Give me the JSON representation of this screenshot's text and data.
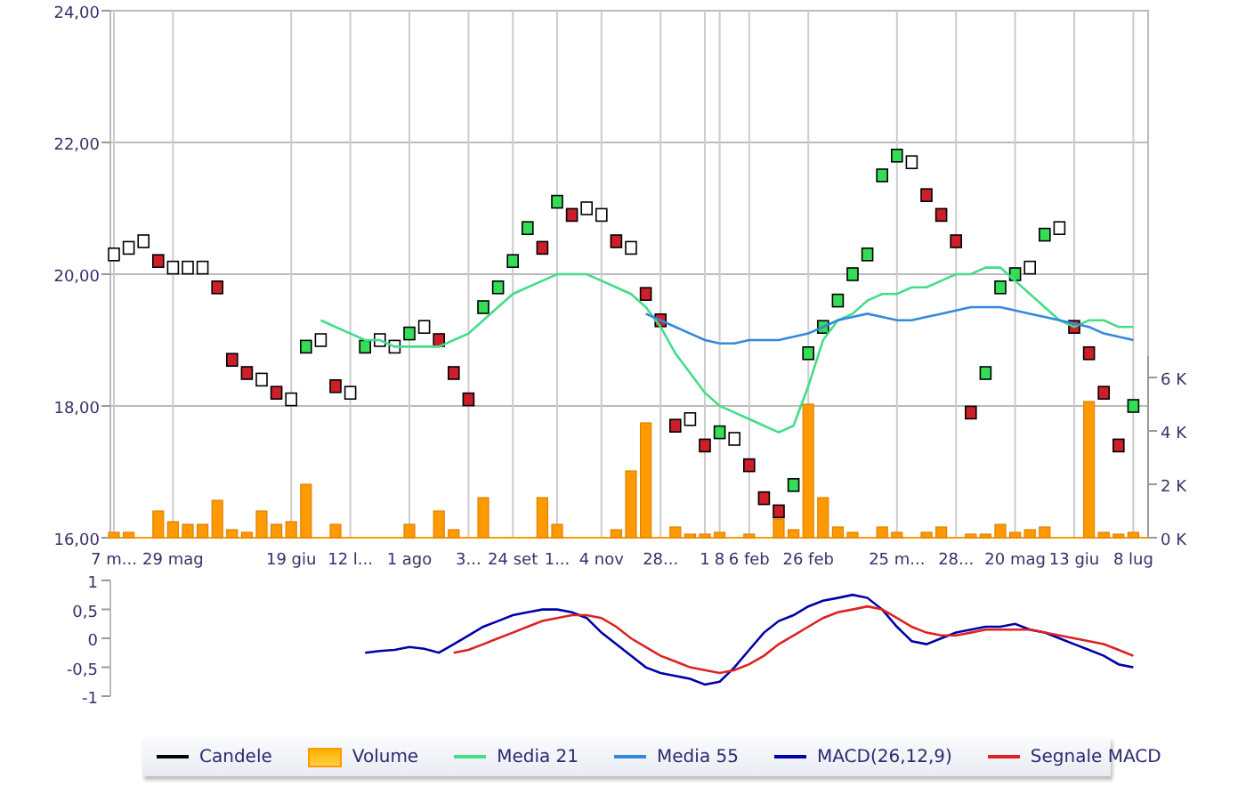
{
  "price_panel": {
    "chart_data": {
      "type": "line",
      "categories": [
        "7 m...",
        null,
        null,
        null,
        "29 mag",
        null,
        null,
        null,
        null,
        null,
        null,
        null,
        "19 giu",
        null,
        null,
        null,
        "12 l...",
        null,
        null,
        null,
        "1 ago",
        null,
        null,
        null,
        "3...",
        null,
        null,
        "24 set",
        null,
        null,
        "1...",
        null,
        null,
        "4 nov",
        null,
        null,
        null,
        "28...",
        null,
        null,
        "1",
        "8",
        null,
        "6 feb",
        null,
        null,
        null,
        "26 feb",
        null,
        null,
        null,
        null,
        null,
        "25 m...",
        null,
        null,
        null,
        "28...",
        null,
        null,
        null,
        "20 mag",
        null,
        null,
        null,
        "13 giu",
        null,
        null,
        null,
        "8 lug"
      ],
      "yticks": [
        {
          "value": 24,
          "label": "24,00"
        },
        {
          "value": 22,
          "label": "22,00"
        },
        {
          "value": 20,
          "label": "20,00"
        },
        {
          "value": 18,
          "label": "18,00"
        },
        {
          "value": 16,
          "label": "16,00"
        }
      ],
      "ylim": [
        16,
        24
      ],
      "grid": true,
      "y2ticks": [
        {
          "value": 6,
          "label": "6 K"
        },
        {
          "value": 4,
          "label": "4 K"
        },
        {
          "value": 2,
          "label": "2 K"
        },
        {
          "value": 0,
          "label": "0 K"
        }
      ],
      "y2lim": [
        0,
        6.8
      ],
      "series": [
        {
          "name": "Candele",
          "type": "scatter",
          "color": "#000000",
          "values": [
            20.3,
            20.4,
            20.5,
            20.2,
            20.1,
            20.1,
            20.1,
            19.8,
            18.7,
            18.5,
            18.4,
            18.2,
            18.1,
            18.9,
            19.0,
            18.3,
            18.2,
            18.9,
            19.0,
            18.9,
            19.1,
            19.2,
            19.0,
            18.5,
            18.1,
            19.5,
            19.8,
            20.2,
            20.7,
            20.4,
            21.1,
            20.9,
            21.0,
            20.9,
            20.5,
            20.4,
            19.7,
            19.3,
            17.7,
            17.8,
            17.4,
            17.6,
            17.5,
            17.1,
            16.6,
            16.4,
            16.8,
            18.8,
            19.2,
            19.6,
            20.0,
            20.3,
            21.5,
            21.8,
            21.7,
            21.2,
            20.9,
            20.5,
            17.9,
            18.5,
            19.8,
            20.0,
            20.1,
            20.6,
            20.7,
            19.2,
            18.8,
            18.2,
            17.4,
            18.0
          ]
        },
        {
          "name": "Volume",
          "type": "bar",
          "axis": "y2",
          "color": "#ff9900",
          "values": [
            0.2,
            0.2,
            0,
            1.0,
            0.6,
            0.5,
            0.5,
            1.4,
            0.3,
            0.2,
            1.0,
            0.5,
            0.6,
            2.0,
            0,
            0.5,
            0,
            0,
            0,
            0,
            0.5,
            0,
            1.0,
            0.3,
            0,
            1.5,
            0,
            0,
            0,
            1.5,
            0.5,
            0,
            0,
            0,
            0.3,
            2.5,
            4.3,
            0,
            0.4,
            0.1,
            0.1,
            0.2,
            0,
            0.1,
            0,
            0.7,
            0.3,
            5.0,
            1.5,
            0.4,
            0.2,
            0,
            0.4,
            0.2,
            0,
            0.2,
            0.4,
            0,
            0.1,
            0.1,
            0.5,
            0.2,
            0.3,
            0.4,
            0,
            0,
            5.1,
            0.2,
            0.1,
            0.2
          ]
        },
        {
          "name": "Media 21",
          "type": "line",
          "color": "#44dd88",
          "values": [
            null,
            null,
            null,
            null,
            null,
            null,
            null,
            null,
            null,
            null,
            null,
            null,
            null,
            null,
            19.3,
            19.2,
            19.1,
            19.0,
            19.0,
            18.9,
            18.9,
            18.9,
            18.9,
            19.0,
            19.1,
            19.3,
            19.5,
            19.7,
            19.8,
            19.9,
            20.0,
            20.0,
            20.0,
            19.9,
            19.8,
            19.7,
            19.5,
            19.2,
            18.8,
            18.5,
            18.2,
            18.0,
            17.9,
            17.8,
            17.7,
            17.6,
            17.7,
            18.3,
            19.0,
            19.3,
            19.4,
            19.6,
            19.7,
            19.7,
            19.8,
            19.8,
            19.9,
            20.0,
            20.0,
            20.1,
            20.1,
            19.9,
            19.7,
            19.5,
            19.3,
            19.2,
            19.3,
            19.3,
            19.2,
            19.2
          ]
        },
        {
          "name": "Media 55",
          "type": "line",
          "color": "#3388dd",
          "values": [
            null,
            null,
            null,
            null,
            null,
            null,
            null,
            null,
            null,
            null,
            null,
            null,
            null,
            null,
            null,
            null,
            null,
            null,
            null,
            null,
            null,
            null,
            null,
            null,
            null,
            null,
            null,
            null,
            null,
            null,
            null,
            null,
            null,
            null,
            null,
            null,
            19.4,
            19.3,
            19.2,
            19.1,
            19.0,
            18.95,
            18.95,
            19.0,
            19.0,
            19.0,
            19.05,
            19.1,
            19.2,
            19.3,
            19.35,
            19.4,
            19.35,
            19.3,
            19.3,
            19.35,
            19.4,
            19.45,
            19.5,
            19.5,
            19.5,
            19.45,
            19.4,
            19.35,
            19.3,
            19.25,
            19.2,
            19.1,
            19.05,
            19.0
          ]
        }
      ]
    }
  },
  "macd_panel": {
    "chart_data": {
      "type": "line",
      "categories": [
        null,
        null,
        null,
        null,
        null,
        null,
        null,
        null,
        null,
        null,
        null,
        null,
        null,
        null,
        null,
        null,
        null,
        null,
        null,
        null,
        null,
        null,
        null,
        null,
        null,
        null,
        null,
        null,
        null,
        null,
        null,
        null,
        null,
        null,
        null,
        null,
        null,
        null,
        null,
        null,
        null,
        null,
        null,
        null,
        null,
        null,
        null,
        null,
        null,
        null,
        null,
        null,
        null,
        null,
        null,
        null,
        null,
        null,
        null,
        null,
        null,
        null,
        null,
        null,
        null,
        null,
        null,
        null,
        null,
        null
      ],
      "yticks": [
        {
          "value": 1,
          "label": "1"
        },
        {
          "value": 0.5,
          "label": "0,5"
        },
        {
          "value": 0,
          "label": "0"
        },
        {
          "value": -0.5,
          "label": "-0,5"
        },
        {
          "value": -1,
          "label": "-1"
        }
      ],
      "ylim": [
        -1,
        1
      ],
      "series": [
        {
          "name": "MACD(26,12,9)",
          "color": "#0000aa",
          "values": [
            null,
            null,
            null,
            null,
            null,
            null,
            null,
            null,
            null,
            null,
            null,
            null,
            null,
            null,
            null,
            null,
            null,
            -0.25,
            -0.22,
            -0.2,
            -0.15,
            -0.18,
            -0.25,
            -0.1,
            0.05,
            0.2,
            0.3,
            0.4,
            0.45,
            0.5,
            0.5,
            0.45,
            0.35,
            0.1,
            -0.1,
            -0.3,
            -0.5,
            -0.6,
            -0.65,
            -0.7,
            -0.8,
            -0.75,
            -0.5,
            -0.2,
            0.1,
            0.3,
            0.4,
            0.55,
            0.65,
            0.7,
            0.75,
            0.7,
            0.5,
            0.2,
            -0.05,
            -0.1,
            0.0,
            0.1,
            0.15,
            0.2,
            0.2,
            0.25,
            0.15,
            0.1,
            0.0,
            -0.1,
            -0.2,
            -0.3,
            -0.45,
            -0.5
          ]
        },
        {
          "name": "Segnale MACD",
          "color": "#dd2222",
          "values": [
            null,
            null,
            null,
            null,
            null,
            null,
            null,
            null,
            null,
            null,
            null,
            null,
            null,
            null,
            null,
            null,
            null,
            null,
            null,
            null,
            null,
            null,
            null,
            -0.25,
            -0.2,
            -0.1,
            0.0,
            0.1,
            0.2,
            0.3,
            0.35,
            0.4,
            0.4,
            0.35,
            0.2,
            0.0,
            -0.15,
            -0.3,
            -0.4,
            -0.5,
            -0.55,
            -0.6,
            -0.55,
            -0.45,
            -0.3,
            -0.1,
            0.05,
            0.2,
            0.35,
            0.45,
            0.5,
            0.55,
            0.5,
            0.35,
            0.2,
            0.1,
            0.05,
            0.05,
            0.1,
            0.15,
            0.15,
            0.15,
            0.15,
            0.1,
            0.05,
            0.0,
            -0.05,
            -0.1,
            -0.2,
            -0.3
          ]
        }
      ]
    }
  }
}
